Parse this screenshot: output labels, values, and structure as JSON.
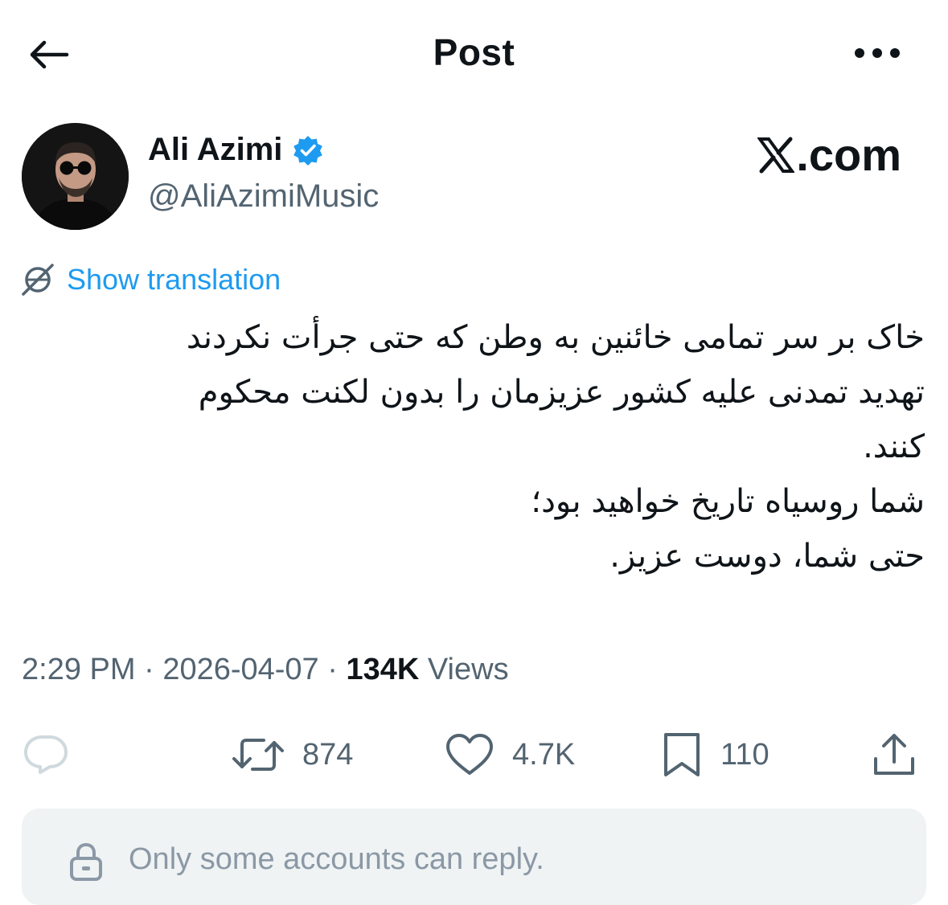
{
  "header": {
    "title": "Post",
    "back_icon": "arrow-left-icon",
    "more_icon": "more-horizontal-icon"
  },
  "author": {
    "name": "Ali Azimi",
    "handle": "@AliAzimiMusic",
    "verified": true,
    "verified_color": "#1d9bf0"
  },
  "watermark": {
    "text": ".com",
    "icon": "x-logo-icon"
  },
  "translation": {
    "label": "Show translation",
    "icon": "translate-icon",
    "color": "#1d9bf0"
  },
  "tweet": {
    "lines": [
      "خاک بر سر تمامی خائنین به وطن که حتی جرأت نکردند",
      "تهدید تمدنی علیه کشور عزیزمان را بدون لکنت محکوم",
      "کنند.",
      "شما روسیاه تاریخ خواهید بود؛",
      "حتی شما، دوست عزیز."
    ]
  },
  "meta": {
    "time": "2:29 PM",
    "separator": "·",
    "date": "2026-04-07",
    "views_count": "134K",
    "views_label": "Views"
  },
  "actions": {
    "reply": {
      "icon": "reply-icon",
      "count": ""
    },
    "repost": {
      "icon": "repost-icon",
      "count": "874"
    },
    "like": {
      "icon": "heart-icon",
      "count": "4.7K"
    },
    "bookmark": {
      "icon": "bookmark-icon",
      "count": "110"
    },
    "share": {
      "icon": "share-icon"
    }
  },
  "reply_restriction": {
    "icon": "lock-icon",
    "text": "Only some accounts can reply."
  },
  "colors": {
    "text_primary": "#0f1419",
    "text_secondary": "#536471",
    "banner_bg": "#eff3f4"
  }
}
